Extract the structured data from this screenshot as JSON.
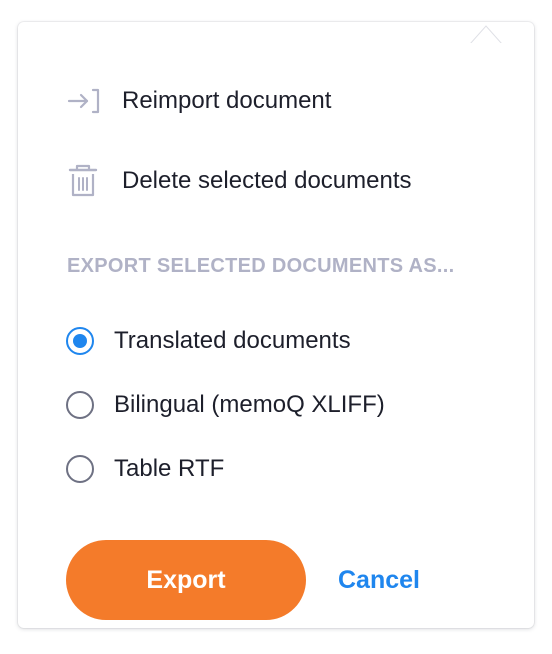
{
  "menu": {
    "reimport": {
      "label": "Reimport document",
      "icon": "reimport-icon"
    },
    "delete": {
      "label": "Delete selected documents",
      "icon": "trash-icon"
    }
  },
  "export": {
    "header": "EXPORT SELECTED DOCUMENTS AS...",
    "options": [
      {
        "label": "Translated documents",
        "selected": true
      },
      {
        "label": "Bilingual (memoQ XLIFF)",
        "selected": false
      },
      {
        "label": "Table RTF",
        "selected": false
      }
    ],
    "export_label": "Export",
    "cancel_label": "Cancel"
  },
  "colors": {
    "accent": "#1f86ee",
    "primary_button": "#f47b2a",
    "icon_muted": "#b0b2c6",
    "text": "#1d1f2b"
  }
}
